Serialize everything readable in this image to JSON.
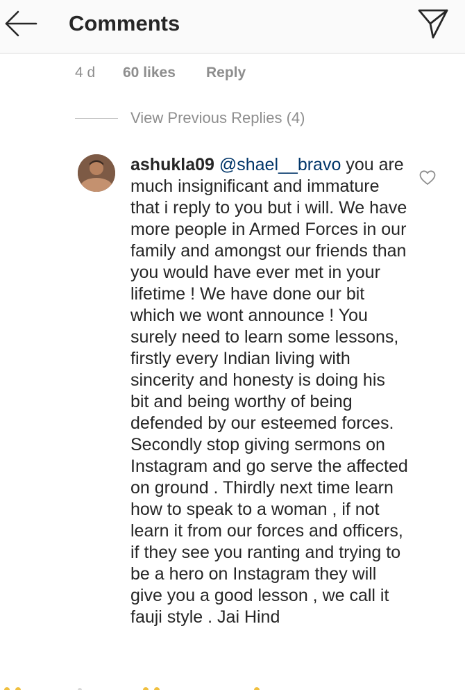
{
  "header": {
    "title": "Comments"
  },
  "parent_comment": {
    "time": "4 d",
    "likes": "60 likes",
    "reply_label": "Reply"
  },
  "replies": {
    "view_previous": "View Previous Replies (4)"
  },
  "reply": {
    "username": "ashukla09",
    "mention": "@shael__bravo",
    "text": " you are much insignificant and immature that i reply to you but i will. We have more people in Armed Forces in our family and amongst our friends than you would have ever met in your lifetime ! We have done our bit which we wont announce !  You surely need to learn some lessons, firstly every Indian living with sincerity and honesty is doing his bit and being worthy of being defended by our esteemed forces.  Secondly stop giving sermons on Instagram and go serve the affected on ground . Thirdly next time learn how to speak to a woman , if not learn it from our forces and officers, if they see you ranting and trying to be a hero on Instagram they will give you a good lesson , we call it fauji style .  Jai Hind"
  },
  "icons": {
    "back": "arrow-left-icon",
    "send": "paper-plane-icon",
    "like": "heart-outline-icon"
  },
  "colors": {
    "text": "#262626",
    "secondary": "#8e8e8e",
    "mention": "#003569",
    "header_bg": "#fafafa"
  }
}
